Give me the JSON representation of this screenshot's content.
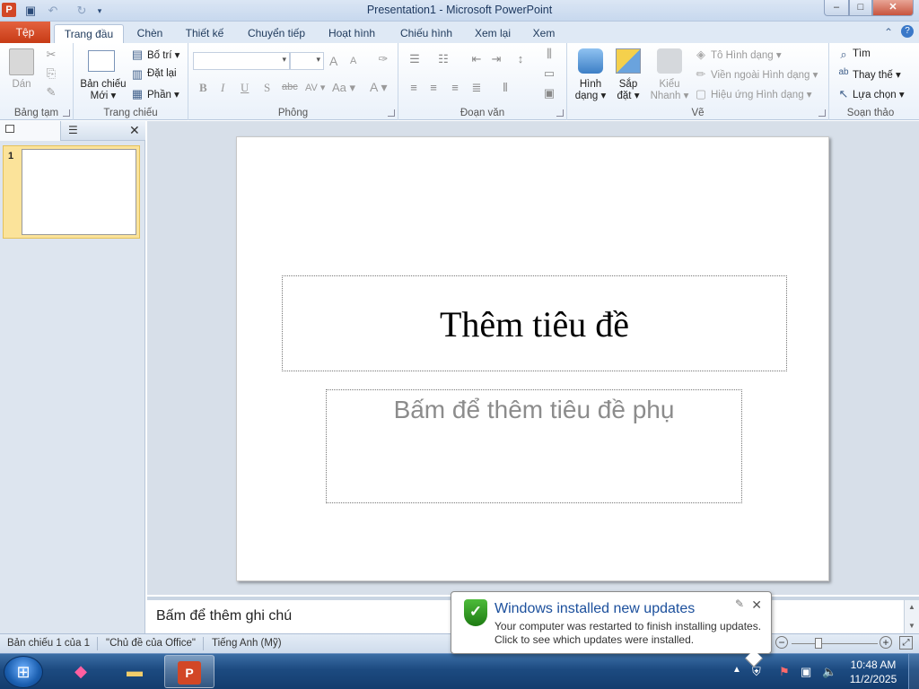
{
  "window": {
    "title": "Presentation1 - Microsoft PowerPoint",
    "app_icon": "P",
    "minimize": "–",
    "maximize": "□",
    "close": "✕"
  },
  "tabs": [
    {
      "label": "Tệp"
    },
    {
      "label": "Trang đầu"
    },
    {
      "label": "Chèn"
    },
    {
      "label": "Thiết kế"
    },
    {
      "label": "Chuyển tiếp"
    },
    {
      "label": "Hoạt hình"
    },
    {
      "label": "Chiếu hình"
    },
    {
      "label": "Xem lại"
    },
    {
      "label": "Xem"
    }
  ],
  "ribbon": {
    "clipboard": {
      "paste": "Dán",
      "group": "Bảng tạm"
    },
    "slides": {
      "new_slide_1": "Bản chiếu",
      "new_slide_2": "Mới",
      "layout": "Bố trí",
      "reset": "Đặt lại",
      "section": "Phần",
      "group": "Trang chiếu"
    },
    "font": {
      "bold": "B",
      "italic": "I",
      "underline": "U",
      "shadow": "S",
      "strike": "abc",
      "spacing": "AV",
      "case": "Aa",
      "color": "A",
      "grow": "A",
      "shrink": "A",
      "group": "Phông"
    },
    "paragraph": {
      "group": "Đoạn văn"
    },
    "drawing": {
      "shape_1": "Hình",
      "shape_2": "dạng",
      "arrange_1": "Sắp",
      "arrange_2": "đặt",
      "quick_1": "Kiểu",
      "quick_2": "Nhanh",
      "fill": "Tô Hình dạng",
      "outline": "Viền ngoài Hình dạng",
      "effects": "Hiệu ứng Hình dạng",
      "group": "Vẽ"
    },
    "editing": {
      "find": "Tìm",
      "replace": "Thay thế",
      "select": "Lựa chọn",
      "group": "Soạn thảo"
    }
  },
  "slide_panel": {
    "slide_number": "1"
  },
  "slide": {
    "title_placeholder": "Thêm tiêu đề",
    "subtitle_placeholder": "Bấm để thêm tiêu đề phụ"
  },
  "notes": {
    "placeholder": "Bấm để thêm ghi chú"
  },
  "status": {
    "slide_of": "Bản chiếu 1 của 1",
    "theme": "\"Chủ đề của Office\"",
    "language": "Tiếng Anh (Mỹ)"
  },
  "notification": {
    "title": "Windows installed new updates",
    "line1": "Your computer was restarted to finish installing updates.",
    "line2": "Click to see which updates were installed."
  },
  "taskbar": {
    "time": "10:48 AM",
    "date": "11/2/2025"
  }
}
